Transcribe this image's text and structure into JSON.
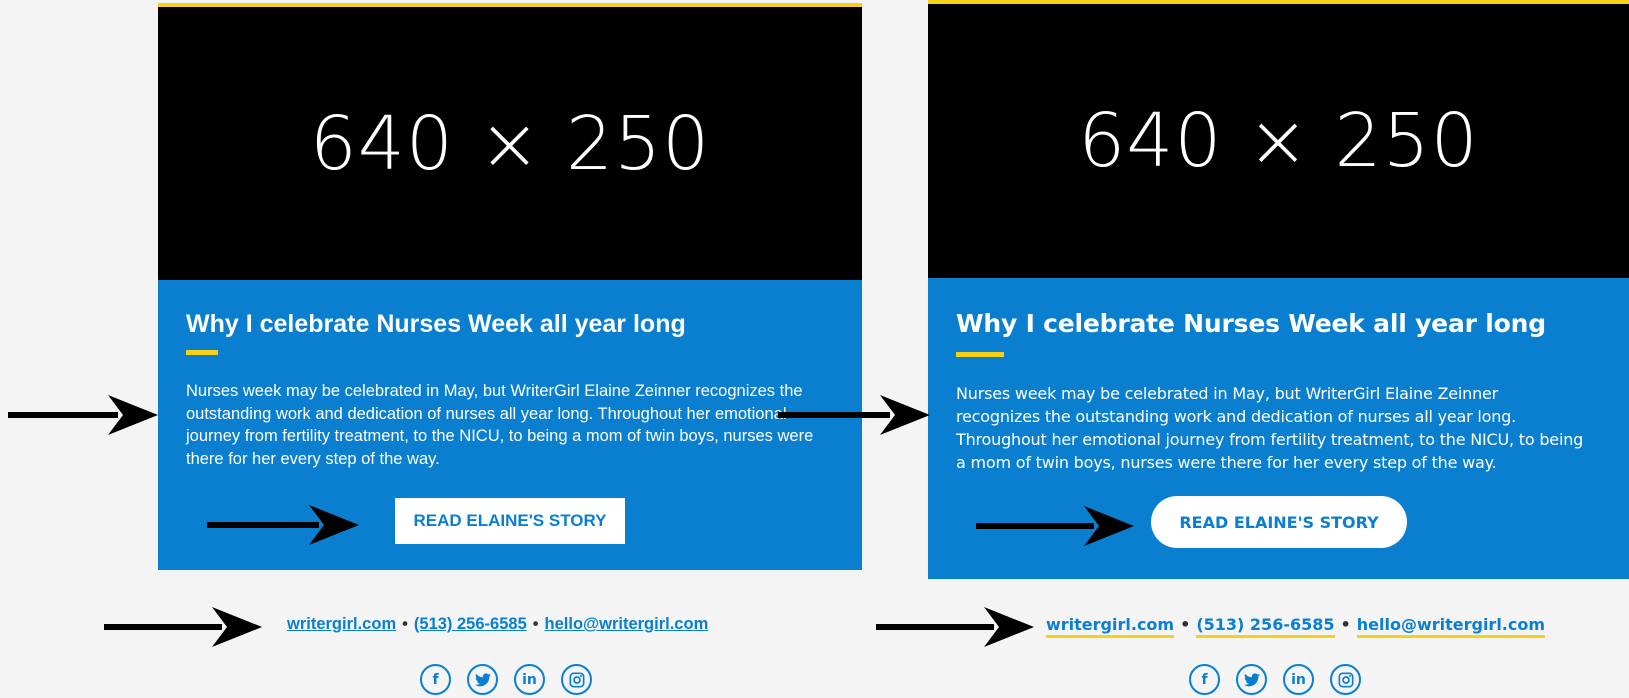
{
  "cards": {
    "left": {
      "placeholder": "640 × 250",
      "title": "Why I celebrate Nurses Week all year long",
      "body": "Nurses week may be celebrated in May, but WriterGirl Elaine Zeinner recognizes the outstanding work and dedication of nurses all year long. Throughout her emotional journey from fertility treatment, to the NICU, to being a mom of twin boys, nurses were there for her every step of the way.",
      "button": "READ ELAINE'S STORY"
    },
    "right": {
      "placeholder": "640 × 250",
      "title": "Why I celebrate Nurses Week all year long",
      "body": "Nurses week may be celebrated in May, but WriterGirl Elaine Zeinner recognizes the outstanding work and dedication of nurses all year long. Throughout her emotional journey from fertility treatment, to the NICU, to being a mom of twin boys, nurses were there for her every step of the way.",
      "button": "READ ELAINE'S STORY"
    }
  },
  "contact": {
    "website": "writergirl.com",
    "phone": "(513) 256-6585",
    "email": "hello@writergirl.com",
    "separator": "•"
  },
  "socials": [
    {
      "icon": "facebook-icon",
      "glyph": "f"
    },
    {
      "icon": "twitter-icon",
      "glyph": "🐦"
    },
    {
      "icon": "linkedin-icon",
      "glyph": "in"
    },
    {
      "icon": "instagram-icon",
      "glyph": "◎"
    }
  ],
  "colors": {
    "brand_blue": "#0a7fd0",
    "accent_yellow": "#f7d117",
    "hero_black": "#000000"
  }
}
